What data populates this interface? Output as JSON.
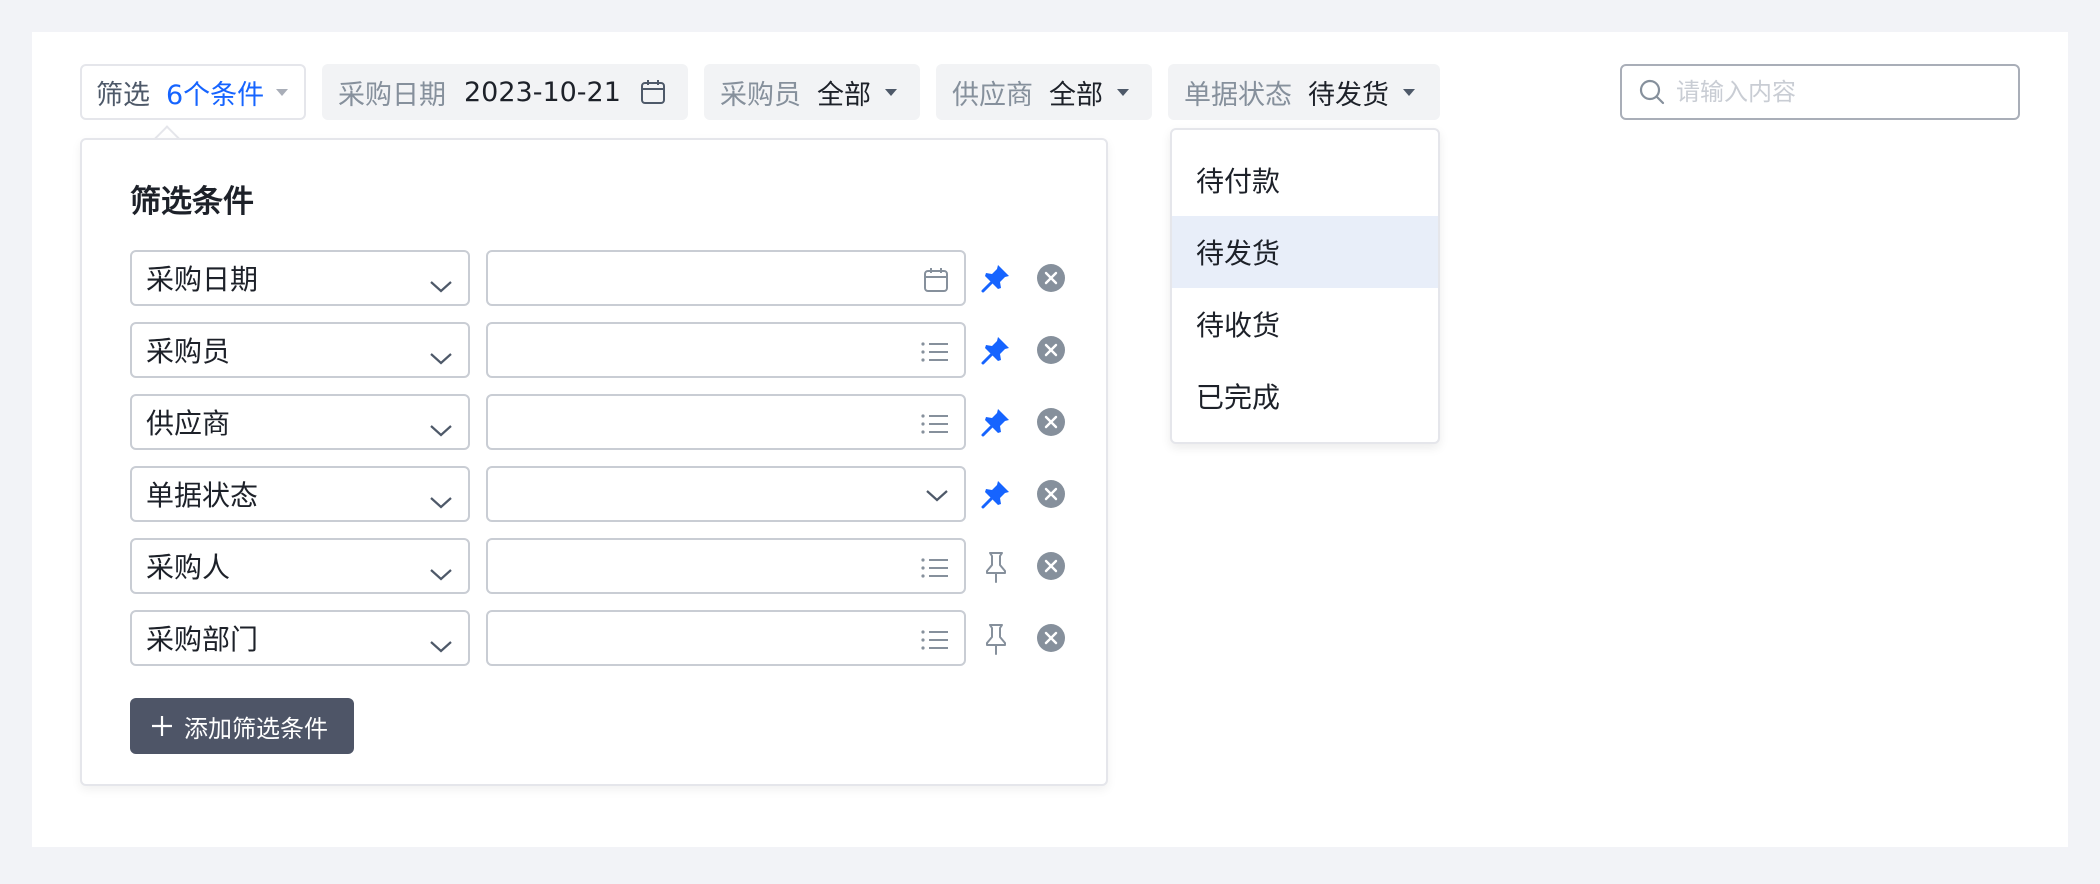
{
  "toolbar": {
    "filter": {
      "label": "筛选",
      "count": "6个条件"
    },
    "date": {
      "label": "采购日期",
      "value": "2023-10-21"
    },
    "buyer": {
      "label": "采购员",
      "value": "全部"
    },
    "supplier": {
      "label": "供应商",
      "value": "全部"
    },
    "status": {
      "label": "单据状态",
      "value": "待发货"
    },
    "search": {
      "placeholder": "请输入内容",
      "value": ""
    }
  },
  "panel": {
    "title": "筛选条件",
    "rows": [
      {
        "field": "采购日期",
        "value": "",
        "value_icon": "calendar-icon",
        "pinned": true
      },
      {
        "field": "采购员",
        "value": "",
        "value_icon": "list-icon",
        "pinned": true
      },
      {
        "field": "供应商",
        "value": "",
        "value_icon": "list-icon",
        "pinned": true
      },
      {
        "field": "单据状态",
        "value": "",
        "value_icon": "chevron-down-icon",
        "pinned": true
      },
      {
        "field": "采购人",
        "value": "",
        "value_icon": "list-icon",
        "pinned": false
      },
      {
        "field": "采购部门",
        "value": "",
        "value_icon": "list-icon",
        "pinned": false
      }
    ],
    "add_button": "添加筛选条件"
  },
  "status_dropdown": {
    "options": [
      "待付款",
      "待发货",
      "待收货",
      "已完成"
    ],
    "selected": "待发货"
  },
  "colors": {
    "accent": "#1664ff",
    "pin_active": "#1664ff",
    "pin_inactive": "#86909c",
    "button_bg": "#4e5567",
    "selected_option_bg": "#e8eef9"
  }
}
